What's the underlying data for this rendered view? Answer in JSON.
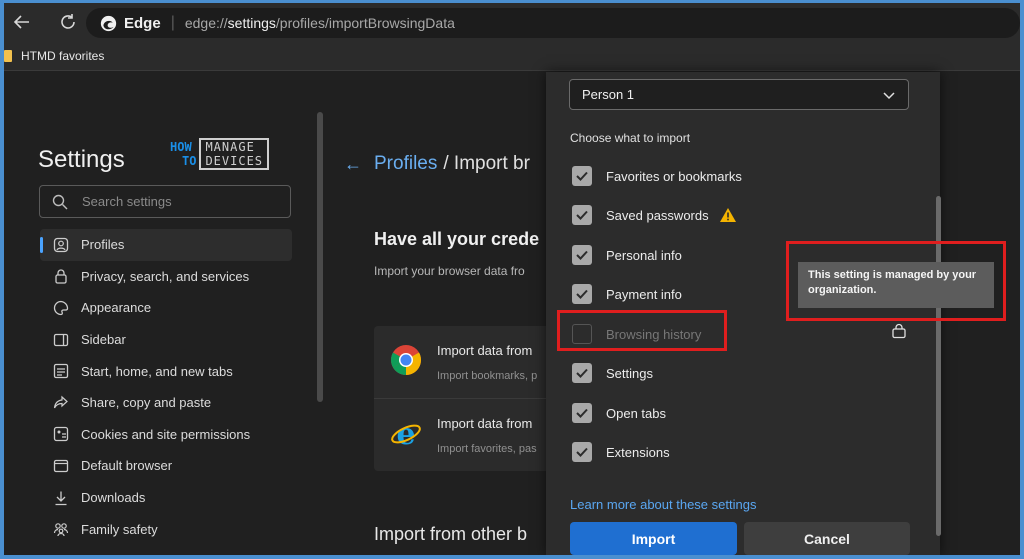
{
  "browser": {
    "name": "Edge",
    "url_prefix": "edge://",
    "url_host": "settings",
    "url_path": "/profiles/importBrowsingData",
    "favorites": "HTMD favorites"
  },
  "sidebar": {
    "title": "Settings",
    "watermark_how": "HOW",
    "watermark_to": "TO",
    "watermark_manage": "MANAGE",
    "watermark_devices": "DEVICES",
    "search_placeholder": "Search settings",
    "items": [
      {
        "label": "Profiles",
        "icon": "profile-icon"
      },
      {
        "label": "Privacy, search, and services",
        "icon": "lock-icon"
      },
      {
        "label": "Appearance",
        "icon": "palette-icon"
      },
      {
        "label": "Sidebar",
        "icon": "sidebar-icon"
      },
      {
        "label": "Start, home, and new tabs",
        "icon": "home-icon"
      },
      {
        "label": "Share, copy and paste",
        "icon": "share-icon"
      },
      {
        "label": "Cookies and site permissions",
        "icon": "cookie-icon"
      },
      {
        "label": "Default browser",
        "icon": "browser-icon"
      },
      {
        "label": "Downloads",
        "icon": "download-icon"
      },
      {
        "label": "Family safety",
        "icon": "family-icon"
      }
    ]
  },
  "main": {
    "crumb_profiles": "Profiles",
    "crumb_rest": "/ Import br",
    "heading": "Have all your crede",
    "subheading": "Import your browser data fro",
    "import_rows": [
      {
        "title": "Import data from",
        "sub": "Import bookmarks, p",
        "icon": "chrome-icon"
      },
      {
        "title": "Import data from",
        "sub": "Import favorites, pas",
        "icon": "ie-icon"
      }
    ],
    "other_heading": "Import from other b"
  },
  "dialog": {
    "profile_select": "Person 1",
    "choose_label": "Choose what to import",
    "options": [
      {
        "label": "Favorites or bookmarks",
        "checked": true
      },
      {
        "label": "Saved passwords",
        "checked": true
      },
      {
        "label": "Personal info",
        "checked": true
      },
      {
        "label": "Payment info",
        "checked": true
      },
      {
        "label": "Browsing history",
        "checked": false
      },
      {
        "label": "Settings",
        "checked": true
      },
      {
        "label": "Open tabs",
        "checked": true
      },
      {
        "label": "Extensions",
        "checked": true
      }
    ],
    "learn_more": "Learn more about these settings",
    "import_button": "Import",
    "cancel_button": "Cancel"
  },
  "tooltip": "This setting is managed by your organization.",
  "colors": {
    "accent": "#1f6fd1",
    "link": "#5aa7f2",
    "annotation": "#e01e1e",
    "warning": "#f5b400"
  }
}
